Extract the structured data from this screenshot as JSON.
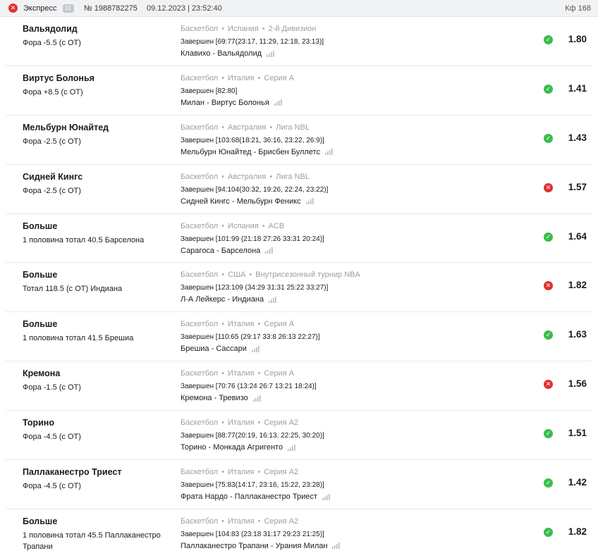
{
  "header": {
    "status_icon": "close-icon",
    "title": "Экспресс",
    "badge": "11",
    "number": "№ 1988782275",
    "datetime": "09.12.2023 | 23:52:40",
    "coefficient": "Кф 168"
  },
  "colors": {
    "won": "#3bbd4a",
    "lost": "#e03131"
  },
  "bets": [
    {
      "name": "Вальядолид",
      "market": "Фора -5.5 (с ОТ)",
      "sport": "Баскетбол",
      "country": "Испания",
      "league": "2-й Дивизион",
      "result": "Завершен [69:77(23:17, 11:29, 12:18, 23:13)]",
      "event": "Клавихо - Вальядолид",
      "status": "won",
      "odds": "1.80"
    },
    {
      "name": "Виртус Болонья",
      "market": "Фора +8.5 (с ОТ)",
      "sport": "Баскетбол",
      "country": "Италия",
      "league": "Серия А",
      "result": "Завершен [82:80]",
      "event": "Милан - Виртус Болонья",
      "status": "won",
      "odds": "1.41"
    },
    {
      "name": "Мельбурн Юнайтед",
      "market": "Фора -2.5 (с ОТ)",
      "sport": "Баскетбол",
      "country": "Австралия",
      "league": "Лига NBL",
      "result": "Завершен [103:68(18:21, 36:16, 23:22, 26:9)]",
      "event": "Мельбурн Юнайтед - Брисбен Буллетс",
      "status": "won",
      "odds": "1.43"
    },
    {
      "name": "Сидней Кингс",
      "market": "Фора -2.5 (с ОТ)",
      "sport": "Баскетбол",
      "country": "Австралия",
      "league": "Лига NBL",
      "result": "Завершен [94:104(30:32, 19:26, 22:24, 23:22)]",
      "event": "Сидней Кингс - Мельбурн Феникс",
      "status": "lost",
      "odds": "1.57"
    },
    {
      "name": "Больше",
      "market": "1 половина тотал 40.5 Барселона",
      "sport": "Баскетбол",
      "country": "Испания",
      "league": "ACB",
      "result": "Завершен [101:99 (21:18 27:26 33:31 20:24)]",
      "event": "Сарагоса - Барселона",
      "status": "won",
      "odds": "1.64"
    },
    {
      "name": "Больше",
      "market": "Тотал 118.5 (с ОТ) Индиана",
      "sport": "Баскетбол",
      "country": "США",
      "league": "Внутрисезонный турнир NBA",
      "result": "Завершен [123:109 (34:29 31:31 25:22 33:27)]",
      "event": "Л-А Лейкерс - Индиана",
      "status": "lost",
      "odds": "1.82"
    },
    {
      "name": "Больше",
      "market": "1 половина тотал 41.5 Брешиа",
      "sport": "Баскетбол",
      "country": "Италия",
      "league": "Серия А",
      "result": "Завершен [110:65 (29:17 33:8 26:13 22:27)]",
      "event": "Брешиа - Сассари",
      "status": "won",
      "odds": "1.63"
    },
    {
      "name": "Кремона",
      "market": "Фора -1.5 (с ОТ)",
      "sport": "Баскетбол",
      "country": "Италия",
      "league": "Серия А",
      "result": "Завершен [70:76 (13:24 26:7 13:21 18:24)]",
      "event": "Кремона - Тревизо",
      "status": "lost",
      "odds": "1.56"
    },
    {
      "name": "Торино",
      "market": "Фора -4.5 (с ОТ)",
      "sport": "Баскетбол",
      "country": "Италия",
      "league": "Серия А2",
      "result": "Завершен [88:77(20:19, 16:13, 22:25, 30:20)]",
      "event": "Торино - Монкада Агригенто",
      "status": "won",
      "odds": "1.51"
    },
    {
      "name": "Паллаканестро Триест",
      "market": "Фора -4.5 (с ОТ)",
      "sport": "Баскетбол",
      "country": "Италия",
      "league": "Серия А2",
      "result": "Завершен [75:83(14:17, 23:16, 15:22, 23:28)]",
      "event": "Фрата Нардо - Паллаканестро Триест",
      "status": "won",
      "odds": "1.42"
    },
    {
      "name": "Больше",
      "market": "1 половина тотал 45.5 Паллаканестро Трапани",
      "sport": "Баскетбол",
      "country": "Италия",
      "league": "Серия А2",
      "result": "Завершен [104:83 (23:18 31:17 29:23 21:25)]",
      "event": "Паллаканестро Трапани - Урания Милан",
      "status": "won",
      "odds": "1.82"
    }
  ]
}
